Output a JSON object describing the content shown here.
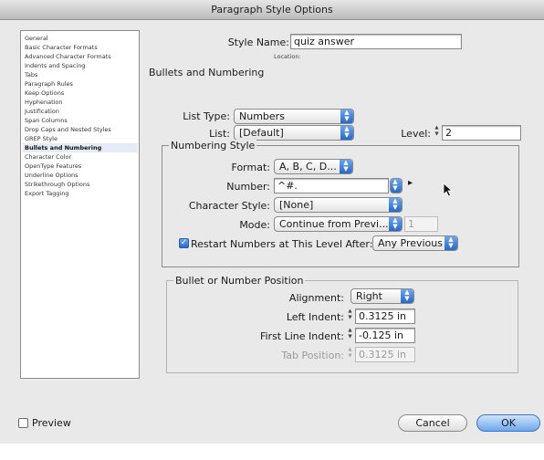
{
  "window": {
    "title": "Paragraph Style Options"
  },
  "sidebar": {
    "items": [
      {
        "label": "General"
      },
      {
        "label": "Basic Character Formats"
      },
      {
        "label": "Advanced Character Formats"
      },
      {
        "label": "Indents and Spacing"
      },
      {
        "label": "Tabs"
      },
      {
        "label": "Paragraph Rules"
      },
      {
        "label": "Keep Options"
      },
      {
        "label": "Hyphenation"
      },
      {
        "label": "Justification"
      },
      {
        "label": "Span Columns"
      },
      {
        "label": "Drop Caps and Nested Styles"
      },
      {
        "label": "GREP Style"
      },
      {
        "label": "Bullets and Numbering",
        "selected": true
      },
      {
        "label": "Character Color"
      },
      {
        "label": "OpenType Features"
      },
      {
        "label": "Underline Options"
      },
      {
        "label": "Strikethrough Options"
      },
      {
        "label": "Export Tagging"
      }
    ]
  },
  "header": {
    "style_name_label": "Style Name:",
    "style_name_value": "quiz answer",
    "location_label": "Location:",
    "section_title": "Bullets and Numbering"
  },
  "list_settings": {
    "list_type_label": "List Type:",
    "list_type_value": "Numbers",
    "list_label": "List:",
    "list_value": "[Default]",
    "level_label": "Level:",
    "level_value": "2"
  },
  "numbering_style": {
    "legend": "Numbering Style",
    "format_label": "Format:",
    "format_value": "A, B, C, D...",
    "number_label": "Number:",
    "number_value": "^#.",
    "number_menu_glyph": "▸",
    "character_style_label": "Character Style:",
    "character_style_value": "[None]",
    "mode_label": "Mode:",
    "mode_value": "Continue from Previ...",
    "mode_start_value": "1",
    "restart_label": "Restart Numbers at This Level After:",
    "restart_checked": true,
    "restart_value": "Any Previous Level"
  },
  "position": {
    "legend": "Bullet or Number Position",
    "alignment_label": "Alignment:",
    "alignment_value": "Right",
    "left_indent_label": "Left Indent:",
    "left_indent_value": "0.3125 in",
    "first_line_indent_label": "First Line Indent:",
    "first_line_indent_value": "-0.125 in",
    "tab_position_label": "Tab Position:",
    "tab_position_value": "0.3125 in"
  },
  "footer": {
    "preview_label": "Preview",
    "preview_checked": false,
    "cancel_label": "Cancel",
    "ok_label": "OK"
  },
  "colors": {
    "accent": "#2a68c8",
    "selected_row": "#e6ecf7",
    "dialog_bg": "#e9e9e9"
  },
  "icons": {
    "popup_arrows": "up-down-arrows-icon",
    "stepper": "stepper-arrows-icon",
    "cursor": "mouse-pointer-icon"
  }
}
